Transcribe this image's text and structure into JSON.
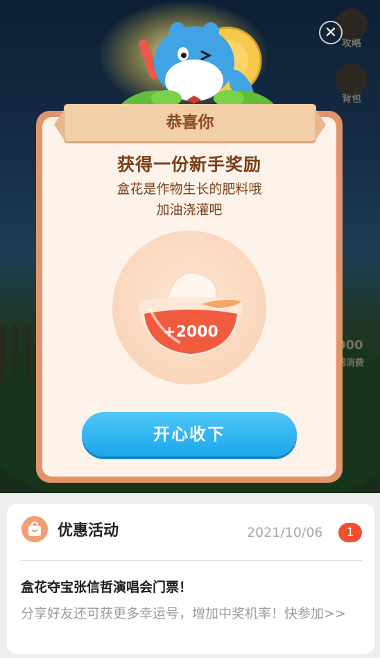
{
  "game": {
    "strategy_label": "攻略",
    "backpack_label": "背包",
    "consume_label": "感消费",
    "consume_value": "000"
  },
  "modal": {
    "ribbon_title": "恭喜你",
    "heading": "获得一份新手奖励",
    "desc_line1": "盒花是作物生长的肥料哦",
    "desc_line2": "加油浇灌吧",
    "reward_value": "+2000",
    "accept_label": "开心收下"
  },
  "message_card": {
    "title": "优惠活动",
    "date": "2021/10/06",
    "badge": "1",
    "message_title": "盒花夺宝张信哲演唱会门票！",
    "message_body": "分享好友还可获更多幸运号，增加中奖机率！快参加>>"
  },
  "colors": {
    "accent_blue": "#1ba6ec",
    "modal_border": "#e2956a",
    "badge_red": "#f0502f",
    "text_brown": "#7a3e17"
  }
}
